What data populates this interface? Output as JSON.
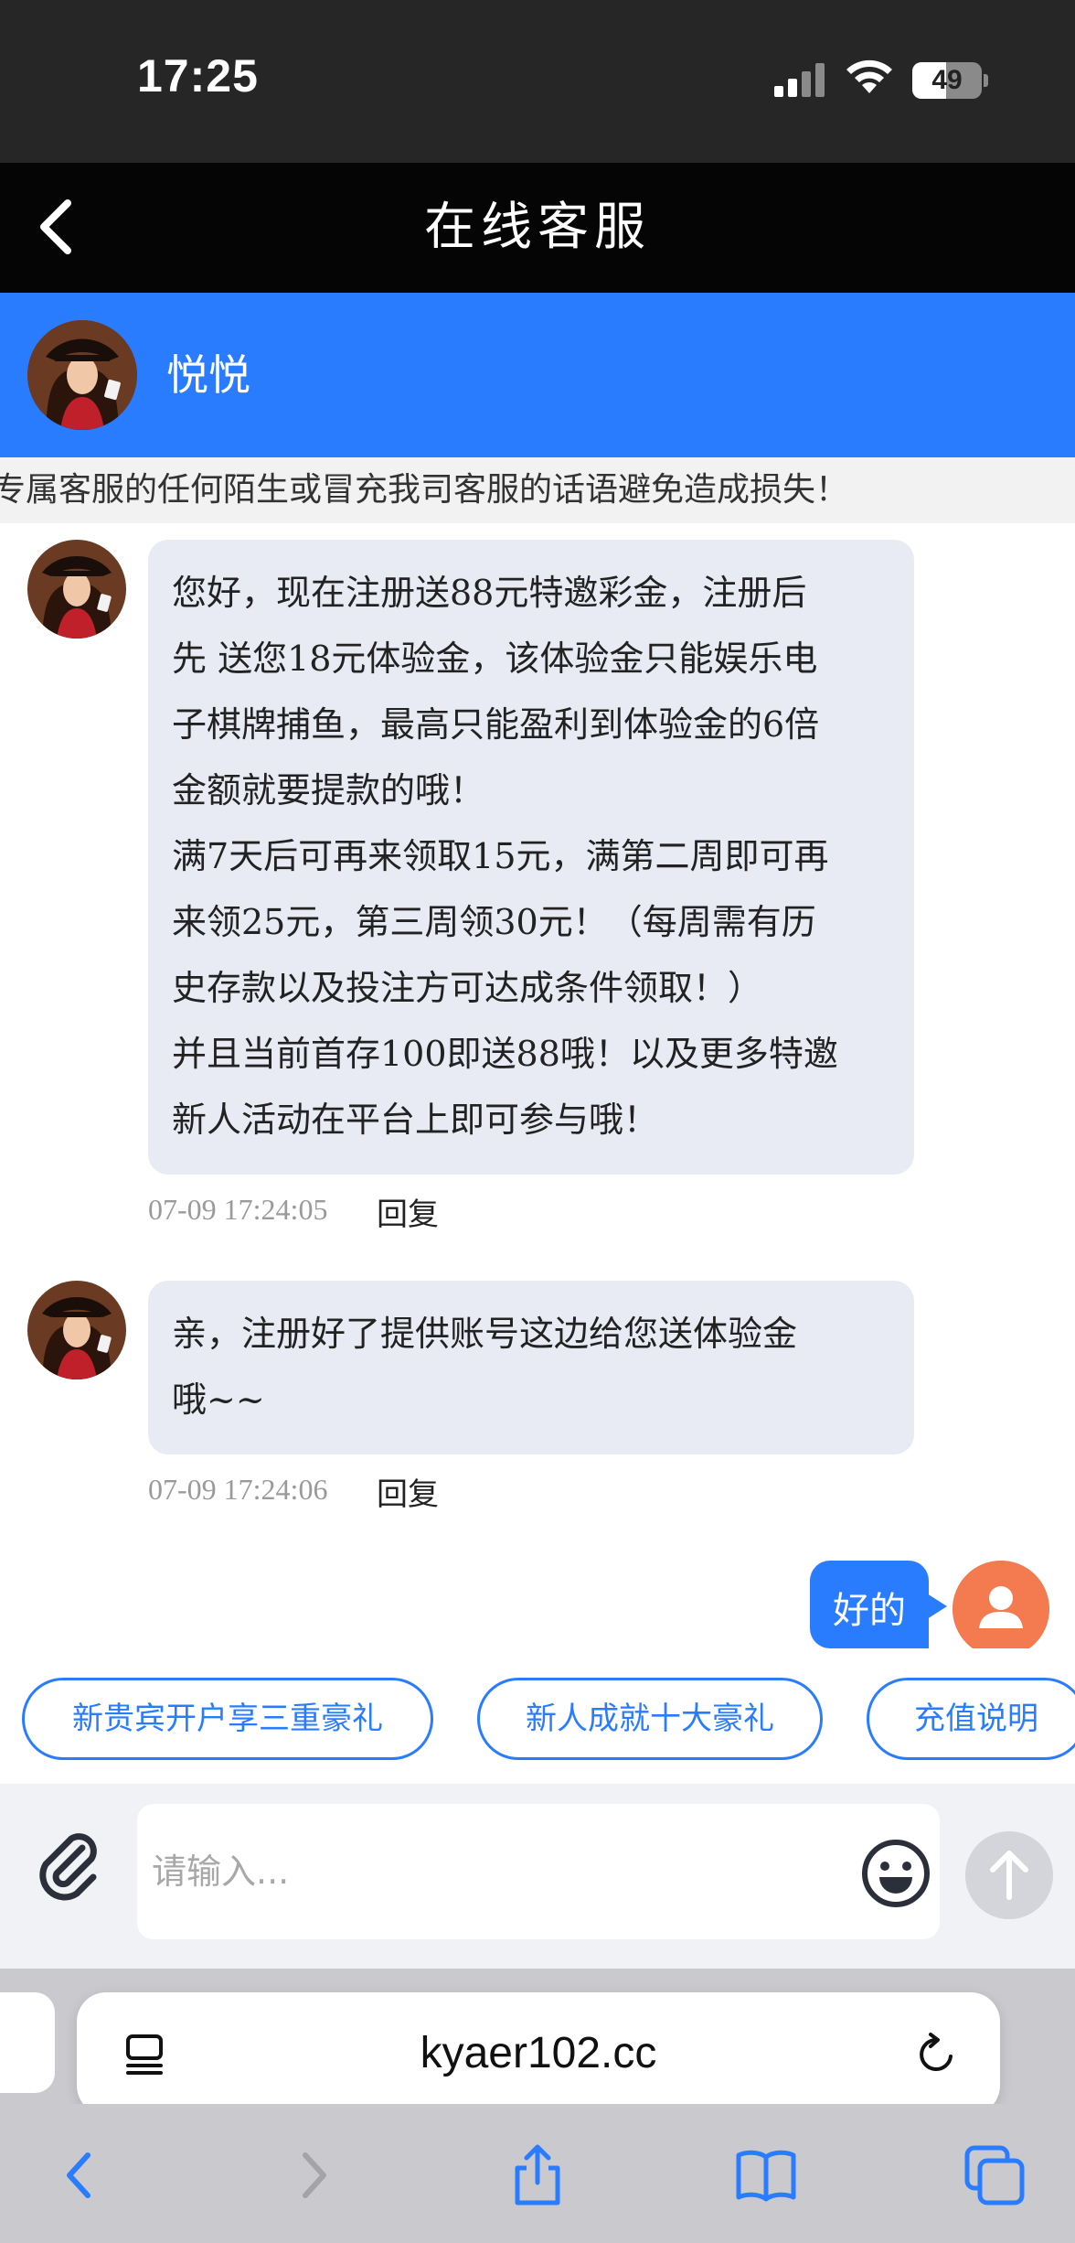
{
  "status_bar": {
    "time": "17:25",
    "battery": "49",
    "battery_level": 0.49
  },
  "header": {
    "title": "在线客服"
  },
  "agent": {
    "name": "悦悦"
  },
  "notice": {
    "text": "专属客服的任何陌生或冒充我司客服的话语避免造成损失！"
  },
  "messages": [
    {
      "lines": [
        "您好，现在注册送88元特邀彩金，注册后",
        "先 送您18元体验金，该体验金只能娱乐电",
        "子棋牌捕鱼，最高只能盈利到体验金的6倍",
        "金额就要提款的哦！",
        "满7天后可再来领取15元，满第二周即可再",
        "来领25元，第三周领30元！（每周需有历",
        "史存款以及投注方可达成条件领取！）",
        "并且当前首存100即送88哦！以及更多特邀",
        "新人活动在平台上即可参与哦！"
      ],
      "timestamp": "07-09 17:24:05",
      "reply_label": "回复"
    },
    {
      "lines": [
        "亲，注册好了提供账号这边给您送体验金",
        "哦~~"
      ],
      "timestamp": "07-09 17:24:06",
      "reply_label": "回复"
    }
  ],
  "my_message": {
    "text": "好的"
  },
  "quick_replies": [
    "新贵宾开户享三重豪礼",
    "新人成就十大豪礼",
    "充值说明"
  ],
  "input": {
    "placeholder": "请输入..."
  },
  "browser": {
    "url": "kyaer102.cc"
  },
  "colors": {
    "primary": "#2a7cff",
    "user_avatar": "#f47a4f",
    "bubble": "#e8ebf3"
  },
  "icons": [
    "back-icon",
    "attach-icon",
    "emoji-icon",
    "send-arrow-icon",
    "reader-icon",
    "reload-icon",
    "safari-back-icon",
    "safari-forward-icon",
    "share-icon",
    "bookmarks-icon",
    "tabs-icon"
  ]
}
